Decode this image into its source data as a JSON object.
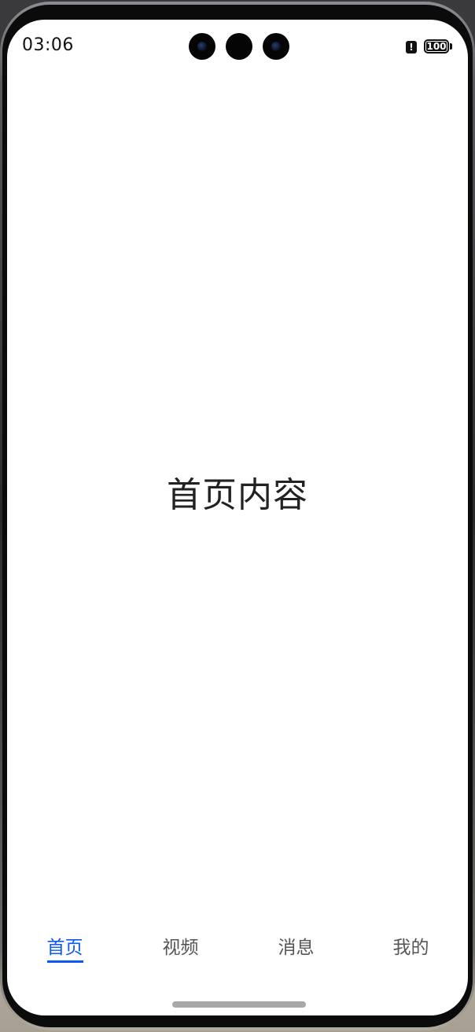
{
  "status_bar": {
    "time": "03:06",
    "alert_glyph": "!",
    "battery_text": "100",
    "battery_level_percent": 100
  },
  "main": {
    "content_text": "首页内容"
  },
  "tabbar": {
    "tabs": [
      {
        "label": "首页",
        "active": true
      },
      {
        "label": "视频",
        "active": false
      },
      {
        "label": "消息",
        "active": false
      },
      {
        "label": "我的",
        "active": false
      }
    ],
    "active_color": "#0a59f7",
    "inactive_color": "#555555"
  },
  "icons": {
    "alert": "alert-icon",
    "battery": "battery-icon",
    "camera": "front-camera-icon"
  }
}
